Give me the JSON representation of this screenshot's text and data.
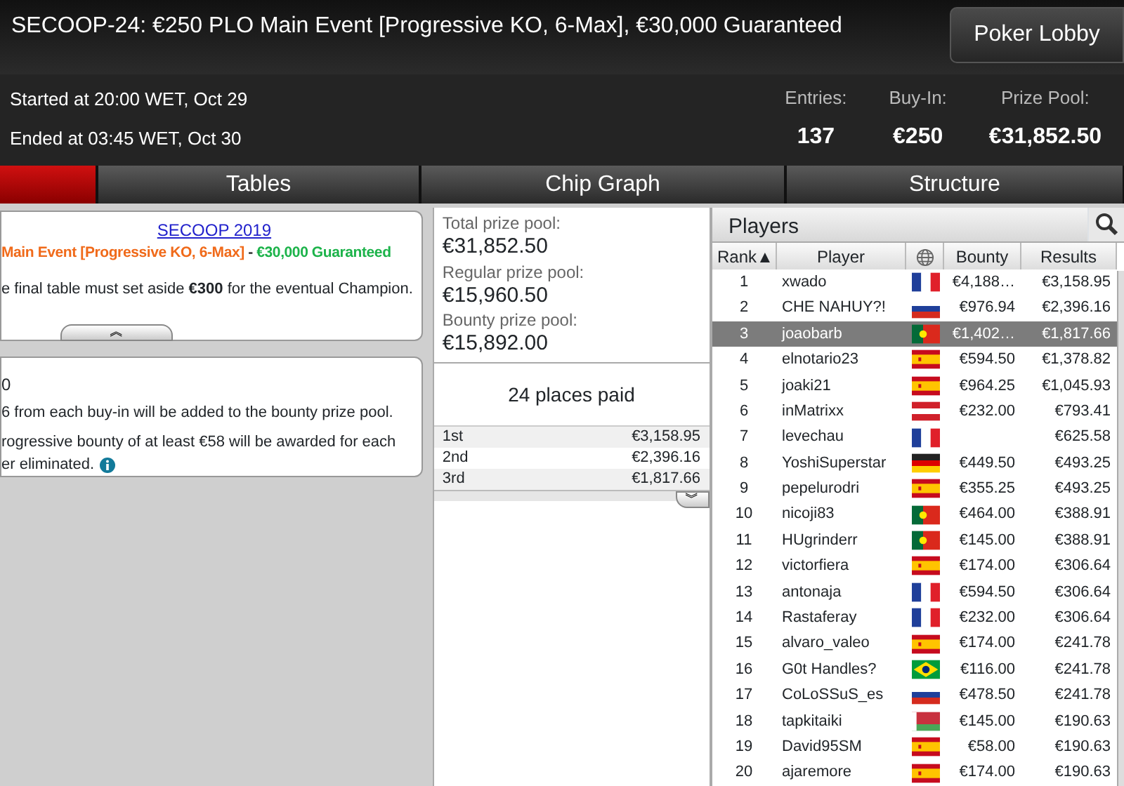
{
  "title": "SECOOP-24: €250 PLO Main Event [Progressive KO, 6-Max], €30,000 Guaranteed",
  "lobby_button": "Poker Lobby",
  "started": "Started at 20:00 WET, Oct 29",
  "ended": "Ended at 03:45 WET, Oct 30",
  "stats": [
    {
      "label": "Entries:",
      "value": "137"
    },
    {
      "label": "Buy-In:",
      "value": "€250"
    },
    {
      "label": "Prize Pool:",
      "value": "€31,852.50"
    }
  ],
  "tabs": [
    {
      "selected": true
    },
    {
      "label": "Tables",
      "selected": false
    },
    {
      "label": "Chip Graph",
      "selected": false
    },
    {
      "label": "Structure",
      "selected": false
    }
  ],
  "info_card": {
    "link": "SECOOP 2019",
    "event": "Main Event [Progressive KO, 6-Max]",
    "separator": " - ",
    "guarantee": "€30,000 Guaranteed",
    "note": "e final table must set aside **€300** for the eventual Champion.",
    "toggle": "︽"
  },
  "bounty_card": {
    "lines": [
      "0",
      "6 from each buy-in will be added to the bounty prize pool.",
      "rogressive bounty of at least €58 will be awarded for each",
      "er eliminated."
    ]
  },
  "prize_pool": {
    "pools": [
      {
        "label": "Total prize pool:",
        "value": "€31,852.50"
      },
      {
        "label": "Regular prize pool:",
        "value": "€15,960.50"
      },
      {
        "label": "Bounty prize pool:",
        "value": "€15,892.00"
      }
    ],
    "places_paid": "24 places paid",
    "payouts": [
      {
        "place": "1st",
        "amount": "€3,158.95"
      },
      {
        "place": "2nd",
        "amount": "€2,396.16"
      },
      {
        "place": "3rd",
        "amount": "€1,817.66"
      }
    ],
    "toggle": "︾"
  },
  "players": {
    "title": "Players",
    "columns": [
      "Rank▲",
      "Player",
      "Bounty",
      "Results"
    ],
    "rows": [
      {
        "rank": "1",
        "name": "xwado",
        "kind": "fr",
        "bounty": "€4,188…",
        "result": "€3,158.95",
        "selected": false
      },
      {
        "rank": "2",
        "name": "CHE NAHUY?!",
        "kind": "ru",
        "bounty": "€976.94",
        "result": "€2,396.16",
        "selected": false
      },
      {
        "rank": "3",
        "name": "joaobarb",
        "kind": "pt",
        "bounty": "€1,402…",
        "result": "€1,817.66",
        "selected": true
      },
      {
        "rank": "4",
        "name": "elnotario23",
        "kind": "es",
        "bounty": "€594.50",
        "result": "€1,378.82",
        "selected": false
      },
      {
        "rank": "5",
        "name": "joaki21",
        "kind": "es",
        "bounty": "€964.25",
        "result": "€1,045.93",
        "selected": false
      },
      {
        "rank": "6",
        "name": "inMatrixx",
        "kind": "at",
        "bounty": "€232.00",
        "result": "€793.41",
        "selected": false
      },
      {
        "rank": "7",
        "name": "levechau",
        "kind": "fr",
        "result": "€625.58",
        "selected": false
      },
      {
        "rank": "8",
        "name": "YoshiSuperstar",
        "kind": "de",
        "bounty": "€449.50",
        "result": "€493.25",
        "selected": false
      },
      {
        "rank": "9",
        "name": "pepelurodri",
        "kind": "es",
        "bounty": "€355.25",
        "result": "€493.25",
        "selected": false
      },
      {
        "rank": "10",
        "name": "nicoji83",
        "kind": "pt",
        "bounty": "€464.00",
        "result": "€388.91",
        "selected": false
      },
      {
        "rank": "11",
        "name": "HUgrinderr",
        "kind": "pt",
        "bounty": "€145.00",
        "result": "€388.91",
        "selected": false
      },
      {
        "rank": "12",
        "name": "victorfiera",
        "kind": "es",
        "bounty": "€174.00",
        "result": "€306.64",
        "selected": false
      },
      {
        "rank": "13",
        "name": "antonaja",
        "kind": "fr",
        "bounty": "€594.50",
        "result": "€306.64",
        "selected": false
      },
      {
        "rank": "14",
        "name": "Rastaferay",
        "kind": "fr",
        "bounty": "€232.00",
        "result": "€306.64",
        "selected": false
      },
      {
        "rank": "15",
        "name": "alvaro_valeo",
        "kind": "es",
        "bounty": "€174.00",
        "result": "€241.78",
        "selected": false
      },
      {
        "rank": "16",
        "name": "G0t Handles?",
        "kind": "br",
        "bounty": "€116.00",
        "result": "€241.78",
        "selected": false
      },
      {
        "rank": "17",
        "name": "CoLoSSuS_es",
        "kind": "ru",
        "bounty": "€478.50",
        "result": "€241.78",
        "selected": false
      },
      {
        "rank": "18",
        "name": "tapkitaiki",
        "kind": "by",
        "bounty": "€145.00",
        "result": "€190.63",
        "selected": false
      },
      {
        "rank": "19",
        "name": "David95SM",
        "kind": "es",
        "bounty": "€58.00",
        "result": "€190.63",
        "selected": false
      },
      {
        "rank": "20",
        "name": "ajaremore",
        "kind": "es",
        "bounty": "€174.00",
        "result": "€190.63",
        "selected": false
      }
    ]
  }
}
